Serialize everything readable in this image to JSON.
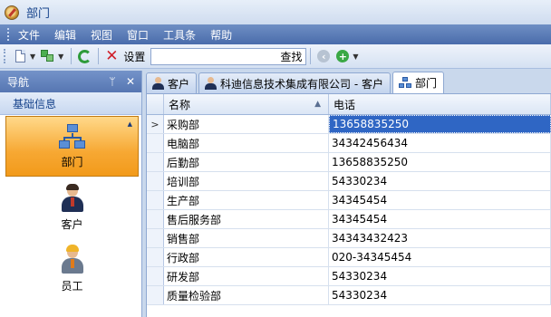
{
  "window": {
    "title": "部门"
  },
  "menu": {
    "items": [
      "文件",
      "编辑",
      "视图",
      "窗口",
      "工具条",
      "帮助"
    ]
  },
  "toolbar": {
    "settings_label": "设置",
    "search_button": "查找",
    "search_value": ""
  },
  "nav": {
    "title": "导航",
    "pin_glyph": "ᛘ",
    "close_glyph": "✕",
    "group_label": "基础信息",
    "items": [
      {
        "label": "部门",
        "icon": "org-chart-icon",
        "active": true
      },
      {
        "label": "客户",
        "icon": "customer-icon",
        "active": false
      },
      {
        "label": "员工",
        "icon": "employee-icon",
        "active": false
      }
    ]
  },
  "tabs": [
    {
      "label": "客户",
      "icon": "customer-icon",
      "active": false
    },
    {
      "label": "科迪信息技术集成有限公司 - 客户",
      "icon": "customer-icon",
      "active": false
    },
    {
      "label": "部门",
      "icon": "org-chart-icon",
      "active": true
    }
  ],
  "grid": {
    "columns": [
      "名称",
      "电话"
    ],
    "current_row_marker": ">",
    "rows": [
      {
        "name": "采购部",
        "phone": "13658835250",
        "selected": true
      },
      {
        "name": "电脑部",
        "phone": "34342456434",
        "selected": false
      },
      {
        "name": "后勤部",
        "phone": "13658835250",
        "selected": false
      },
      {
        "name": "培训部",
        "phone": "54330234",
        "selected": false
      },
      {
        "name": "生产部",
        "phone": "34345454",
        "selected": false
      },
      {
        "name": "售后服务部",
        "phone": "34345454",
        "selected": false
      },
      {
        "name": "销售部",
        "phone": "34343432423",
        "selected": false
      },
      {
        "name": "行政部",
        "phone": "020-34345454",
        "selected": false
      },
      {
        "name": "研发部",
        "phone": "54330234",
        "selected": false
      },
      {
        "name": "质量检验部",
        "phone": "54330234",
        "selected": false
      }
    ]
  },
  "colors": {
    "menubar": "#4a6cab",
    "active_nav": "#f7a833",
    "selection": "#2f66c4"
  }
}
